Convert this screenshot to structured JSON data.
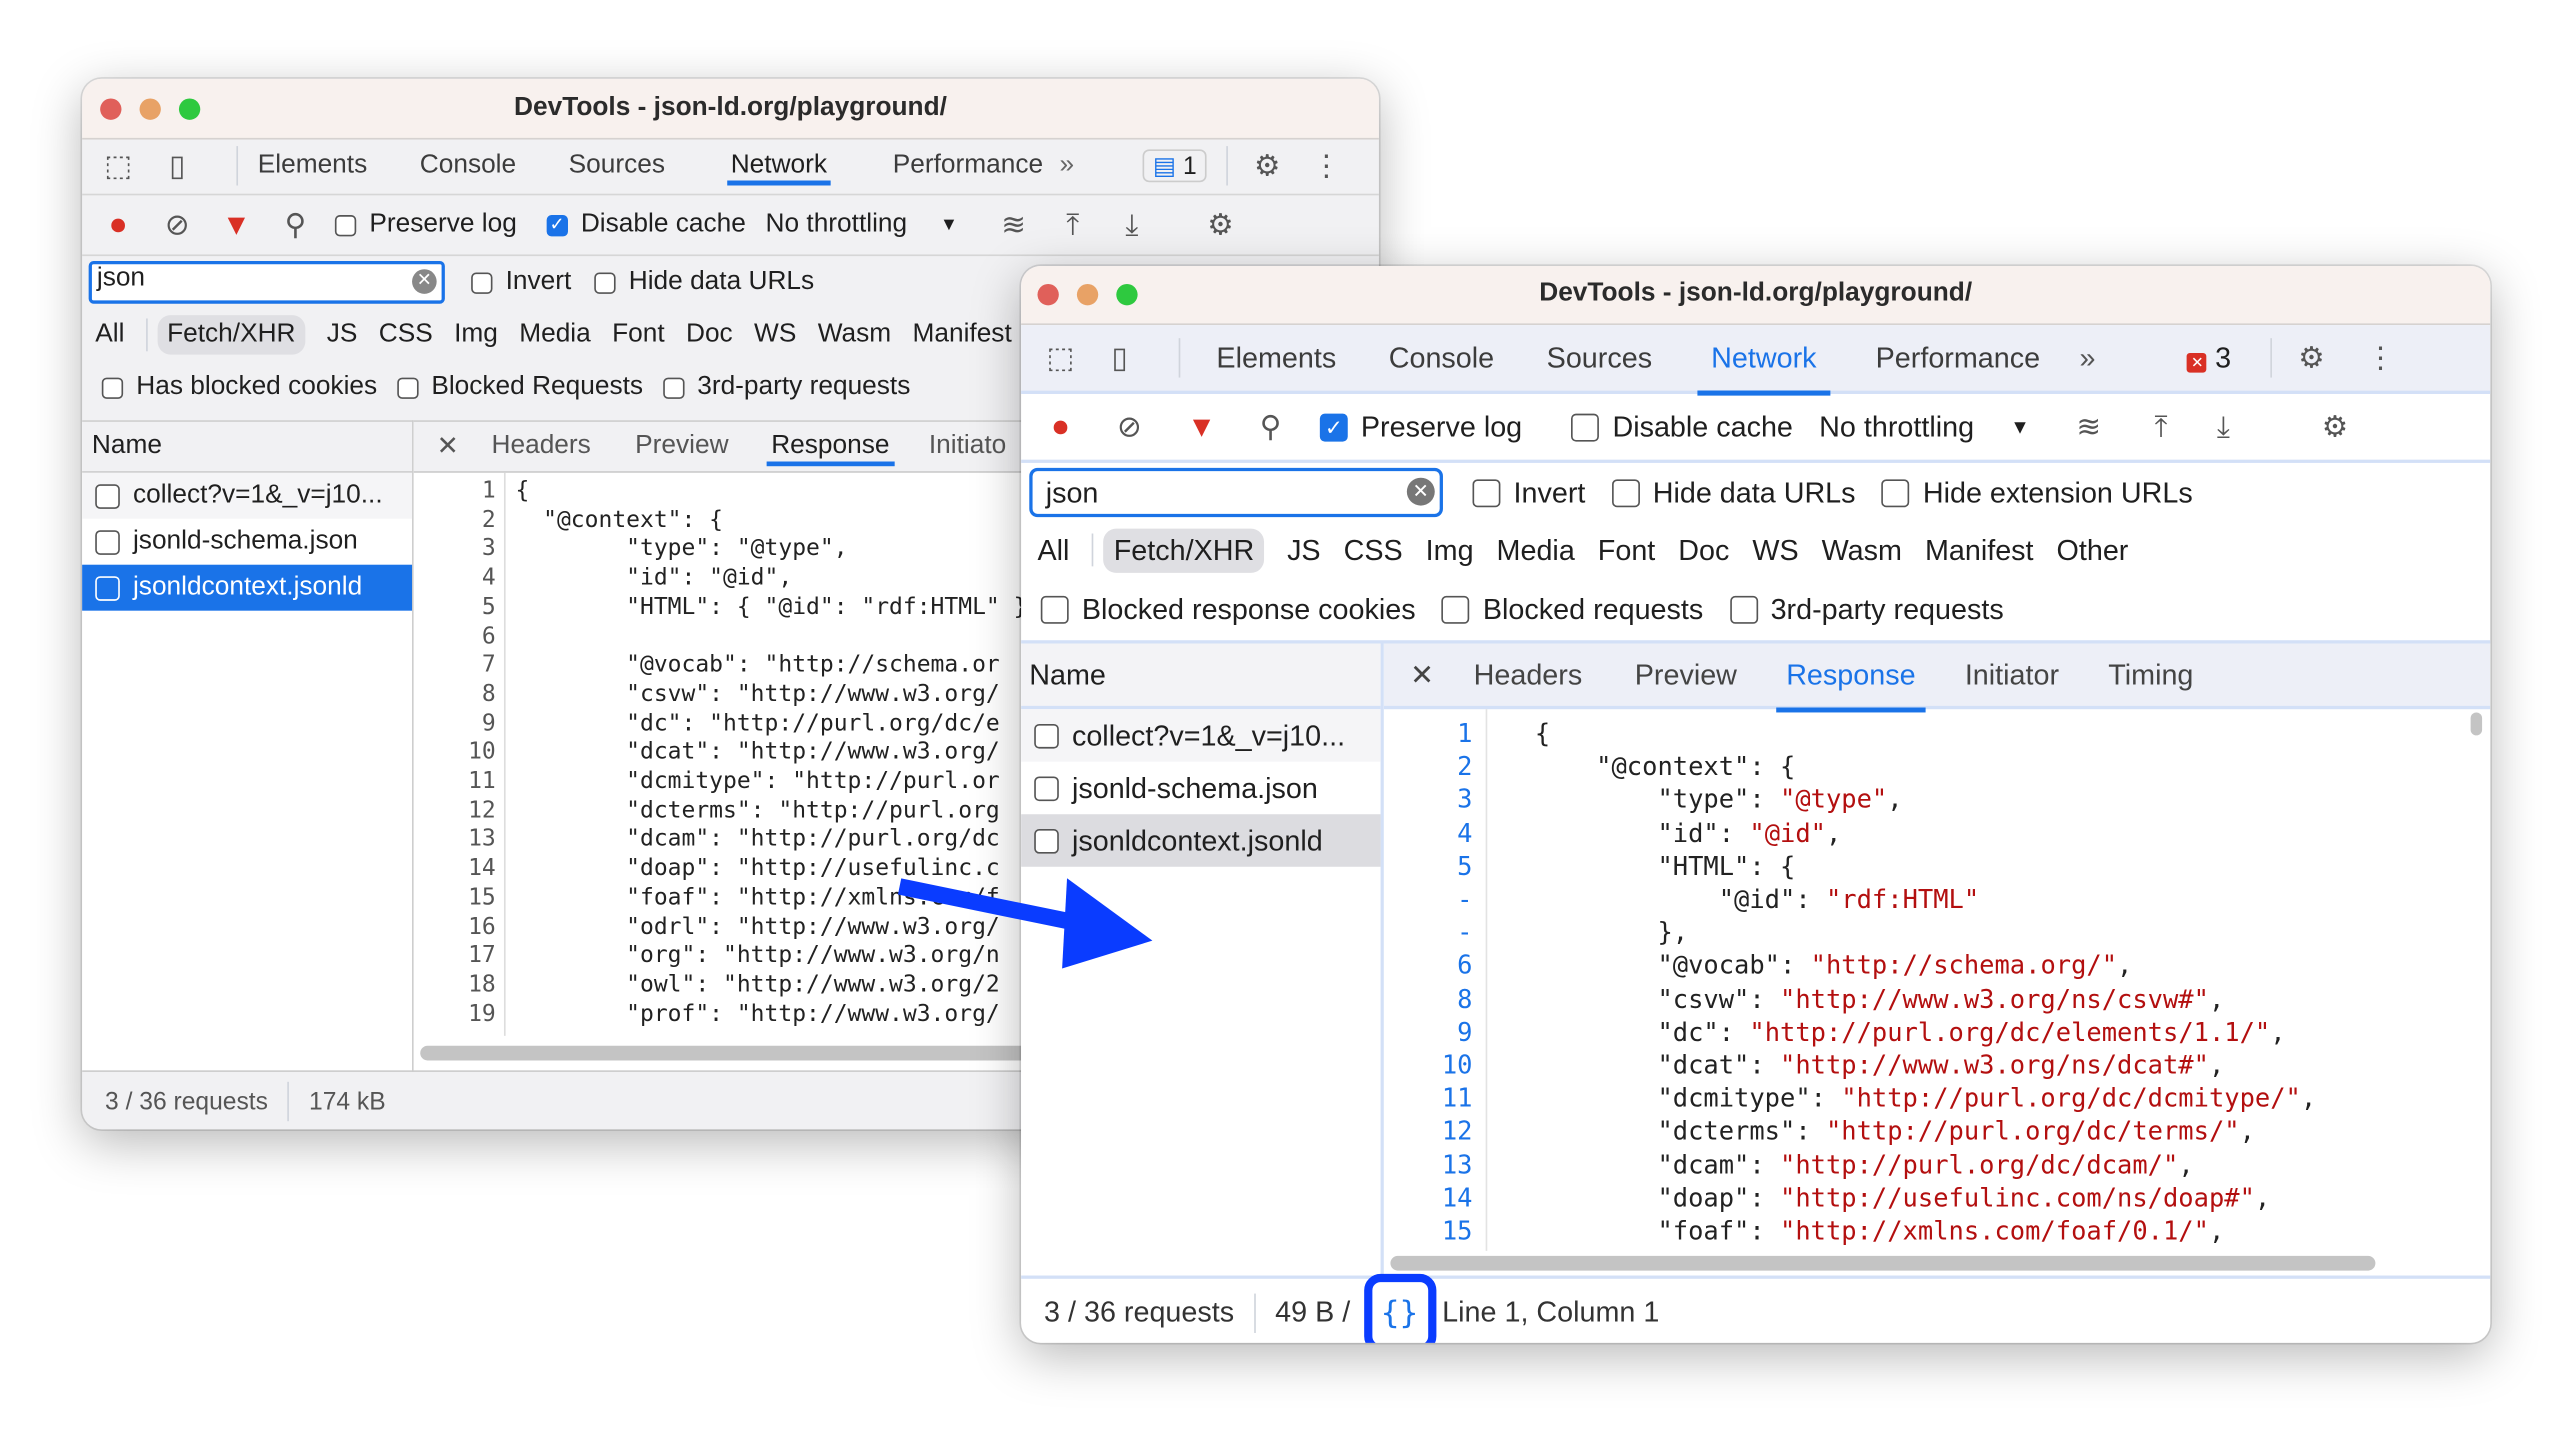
{
  "colors": {
    "accent": "#1a73e8",
    "string": "#b30f0f",
    "annotation": "#0a3cff",
    "selected_row": "#1a73e8"
  },
  "back_window": {
    "title": "DevTools - json-ld.org/playground/",
    "tabs": [
      "Elements",
      "Console",
      "Sources",
      "Network",
      "Performance"
    ],
    "active_tab": "Network",
    "more_tabs_icon": "chevron-double-right-icon",
    "issues_badge": "1",
    "toolbar": {
      "preserve_log": "Preserve log",
      "preserve_log_checked": false,
      "disable_cache": "Disable cache",
      "disable_cache_checked": true,
      "throttling": "No throttling"
    },
    "filter": {
      "value": "json",
      "invert": "Invert",
      "hide_data_urls": "Hide data URLs"
    },
    "types": [
      "All",
      "Fetch/XHR",
      "JS",
      "CSS",
      "Img",
      "Media",
      "Font",
      "Doc",
      "WS",
      "Wasm",
      "Manifest"
    ],
    "active_type": "Fetch/XHR",
    "checks": [
      "Has blocked cookies",
      "Blocked Requests",
      "3rd-party requests"
    ],
    "name_header": "Name",
    "requests": [
      "collect?v=1&_v=j10...",
      "jsonld-schema.json",
      "jsonldcontext.jsonld"
    ],
    "selected_request": 2,
    "detail_tabs": [
      "Headers",
      "Preview",
      "Response",
      "Initiato"
    ],
    "active_detail_tab": "Response",
    "code": [
      {
        "n": "1",
        "t": "{"
      },
      {
        "n": "2",
        "t": "  \"@context\": {"
      },
      {
        "n": "3",
        "t": "        \"type\": \"@type\","
      },
      {
        "n": "4",
        "t": "        \"id\": \"@id\","
      },
      {
        "n": "5",
        "t": "        \"HTML\": { \"@id\": \"rdf:HTML\" },"
      },
      {
        "n": "6",
        "t": ""
      },
      {
        "n": "7",
        "t": "        \"@vocab\": \"http://schema.or"
      },
      {
        "n": "8",
        "t": "        \"csvw\": \"http://www.w3.org/"
      },
      {
        "n": "9",
        "t": "        \"dc\": \"http://purl.org/dc/e"
      },
      {
        "n": "10",
        "t": "        \"dcat\": \"http://www.w3.org/"
      },
      {
        "n": "11",
        "t": "        \"dcmitype\": \"http://purl.or"
      },
      {
        "n": "12",
        "t": "        \"dcterms\": \"http://purl.org"
      },
      {
        "n": "13",
        "t": "        \"dcam\": \"http://purl.org/dc"
      },
      {
        "n": "14",
        "t": "        \"doap\": \"http://usefulinc.c"
      },
      {
        "n": "15",
        "t": "        \"foaf\": \"http://xmlns.com/f"
      },
      {
        "n": "16",
        "t": "        \"odrl\": \"http://www.w3.org/"
      },
      {
        "n": "17",
        "t": "        \"org\": \"http://www.w3.org/n"
      },
      {
        "n": "18",
        "t": "        \"owl\": \"http://www.w3.org/2"
      },
      {
        "n": "19",
        "t": "        \"prof\": \"http://www.w3.org/"
      }
    ],
    "status": {
      "requests": "3 / 36 requests",
      "size": "174 kB"
    }
  },
  "front_window": {
    "title": "DevTools - json-ld.org/playground/",
    "tabs": [
      "Elements",
      "Console",
      "Sources",
      "Network",
      "Performance"
    ],
    "active_tab": "Network",
    "more_tabs_icon": "chevron-double-right-icon",
    "errors_badge": "3",
    "toolbar": {
      "preserve_log": "Preserve log",
      "preserve_log_checked": true,
      "disable_cache": "Disable cache",
      "disable_cache_checked": false,
      "throttling": "No throttling"
    },
    "filter": {
      "value": "json",
      "invert": "Invert",
      "hide_data_urls": "Hide data URLs",
      "hide_extension_urls": "Hide extension URLs"
    },
    "types": [
      "All",
      "Fetch/XHR",
      "JS",
      "CSS",
      "Img",
      "Media",
      "Font",
      "Doc",
      "WS",
      "Wasm",
      "Manifest",
      "Other"
    ],
    "active_type": "Fetch/XHR",
    "checks": [
      "Blocked response cookies",
      "Blocked requests",
      "3rd-party requests"
    ],
    "name_header": "Name",
    "requests": [
      "collect?v=1&_v=j10...",
      "jsonld-schema.json",
      "jsonldcontext.jsonld"
    ],
    "selected_request": 2,
    "detail_tabs": [
      "Headers",
      "Preview",
      "Response",
      "Initiator",
      "Timing"
    ],
    "active_detail_tab": "Response",
    "code": [
      {
        "n": "1",
        "k": "{",
        "v": "",
        "e": ""
      },
      {
        "n": "2",
        "k": "    \"@context\": {",
        "v": "",
        "e": ""
      },
      {
        "n": "3",
        "k": "        \"type\": ",
        "v": "\"@type\"",
        "e": ","
      },
      {
        "n": "4",
        "k": "        \"id\": ",
        "v": "\"@id\"",
        "e": ","
      },
      {
        "n": "5",
        "k": "        \"HTML\": {",
        "v": "",
        "e": ""
      },
      {
        "n": "-",
        "k": "            \"@id\": ",
        "v": "\"rdf:HTML\"",
        "e": ""
      },
      {
        "n": "-",
        "k": "        },",
        "v": "",
        "e": ""
      },
      {
        "n": "6",
        "k": "        \"@vocab\": ",
        "v": "\"http://schema.org/\"",
        "e": ","
      },
      {
        "n": "8",
        "k": "        \"csvw\": ",
        "v": "\"http://www.w3.org/ns/csvw#\"",
        "e": ","
      },
      {
        "n": "9",
        "k": "        \"dc\": ",
        "v": "\"http://purl.org/dc/elements/1.1/\"",
        "e": ","
      },
      {
        "n": "10",
        "k": "        \"dcat\": ",
        "v": "\"http://www.w3.org/ns/dcat#\"",
        "e": ","
      },
      {
        "n": "11",
        "k": "        \"dcmitype\": ",
        "v": "\"http://purl.org/dc/dcmitype/\"",
        "e": ","
      },
      {
        "n": "12",
        "k": "        \"dcterms\": ",
        "v": "\"http://purl.org/dc/terms/\"",
        "e": ","
      },
      {
        "n": "13",
        "k": "        \"dcam\": ",
        "v": "\"http://purl.org/dc/dcam/\"",
        "e": ","
      },
      {
        "n": "14",
        "k": "        \"doap\": ",
        "v": "\"http://usefulinc.com/ns/doap#\"",
        "e": ","
      },
      {
        "n": "15",
        "k": "        \"foaf\": ",
        "v": "\"http://xmlns.com/foaf/0.1/\"",
        "e": ","
      }
    ],
    "status": {
      "requests": "3 / 36 requests",
      "size": "49 B /",
      "pretty_print_icon": "curly-braces-icon",
      "cursor": "Line 1, Column 1"
    }
  }
}
